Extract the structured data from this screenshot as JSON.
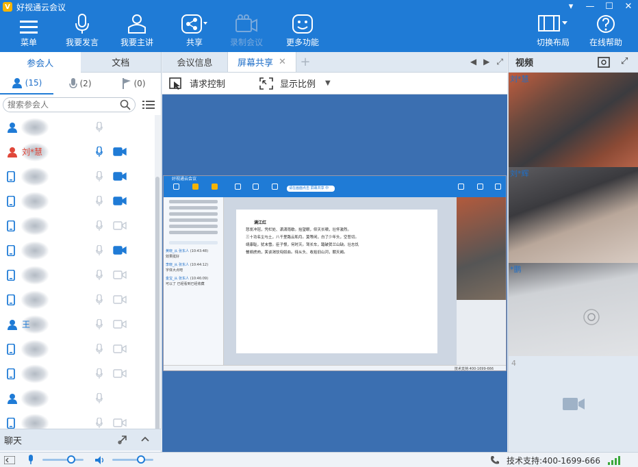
{
  "window": {
    "title": "好视通云会议"
  },
  "toolbar": {
    "menu": "菜单",
    "speak": "我要发言",
    "host": "我要主讲",
    "share": "共享",
    "record": "录制会议",
    "more": "更多功能",
    "layout": "切换布局",
    "help": "在线帮助"
  },
  "left": {
    "tabs": [
      "参会人",
      "文档"
    ],
    "counts": {
      "people": "(15)",
      "mics": "(2)",
      "flags": "(0)"
    },
    "search_placeholder": "搜索参会人",
    "participants": [
      {
        "device": "user",
        "name": "",
        "mic": "off",
        "cam": "none",
        "color": "#1f7bd6"
      },
      {
        "device": "user",
        "name": "刘*慧",
        "mic": "on",
        "cam": "on",
        "color": "#e0473a"
      },
      {
        "device": "phone",
        "name": "",
        "mic": "off",
        "cam": "on",
        "color": "#1f7bd6"
      },
      {
        "device": "phone",
        "name": "",
        "mic": "off",
        "cam": "on",
        "color": "#1f7bd6"
      },
      {
        "device": "phone",
        "name": "",
        "mic": "off",
        "cam": "off",
        "color": "#1f7bd6"
      },
      {
        "device": "phone",
        "name": "",
        "mic": "off",
        "cam": "on",
        "color": "#1f7bd6"
      },
      {
        "device": "phone",
        "name": "",
        "mic": "off",
        "cam": "off",
        "color": "#1f7bd6"
      },
      {
        "device": "phone",
        "name": "",
        "mic": "off",
        "cam": "off",
        "color": "#1f7bd6"
      },
      {
        "device": "user",
        "name": "王",
        "mic": "off",
        "cam": "off",
        "color": "#1f7bd6"
      },
      {
        "device": "phone",
        "name": "",
        "mic": "off",
        "cam": "off",
        "color": "#1f7bd6"
      },
      {
        "device": "phone",
        "name": "",
        "mic": "off",
        "cam": "off",
        "color": "#1f7bd6"
      },
      {
        "device": "user",
        "name": "",
        "mic": "off",
        "cam": "none",
        "color": "#1f7bd6"
      },
      {
        "device": "phone",
        "name": "",
        "mic": "off",
        "cam": "off",
        "color": "#1f7bd6"
      }
    ],
    "chat_label": "聊天"
  },
  "center": {
    "tabs": [
      "会议信息",
      "屏幕共享"
    ],
    "request_control": "请求控制",
    "display_ratio": "显示比例",
    "shared": {
      "title": "好视通云会议",
      "tip": "请在画面点击 屏幕共享 中",
      "doc_title": "满江红",
      "doc_lines": [
        "怒发冲冠，凭栏处、潇潇雨歇。抬望眼，仰天长啸，壮怀激烈。",
        "三十功名尘与土，八千里路云和月。莫等闲，白了少年头，空悲切。",
        "靖康耻，犹未雪。臣子恨，何时灭。驾长车，踏破贺兰山缺。壮志饥",
        "餐胡虏肉，笑谈渴饮匈奴血。待从头、收拾旧山河，朝天阙。"
      ],
      "chat": [
        {
          "user": "黄晓_从 张东人",
          "time": "(10:43:48)",
          "text": "效果挺好"
        },
        {
          "user": "李晓_从 张东人",
          "time": "(10:44:12)",
          "text": "字体大点吧"
        },
        {
          "user": "金宝_从 张东人",
          "time": "(10:46:09)",
          "text": "可以了  已经看到已经收藏"
        }
      ],
      "support": "技术支持:400-1699-666"
    }
  },
  "right": {
    "title": "视频",
    "tiles": [
      {
        "label": "刘*慧",
        "bg": "#b35a3c"
      },
      {
        "label": "刘*辉",
        "bg": "#8a7b6a"
      },
      {
        "label": "*鹏",
        "bg": "#d5d7dc"
      }
    ],
    "empty_tile_number": "4"
  },
  "status": {
    "support": "技术支持:400-1699-666"
  }
}
